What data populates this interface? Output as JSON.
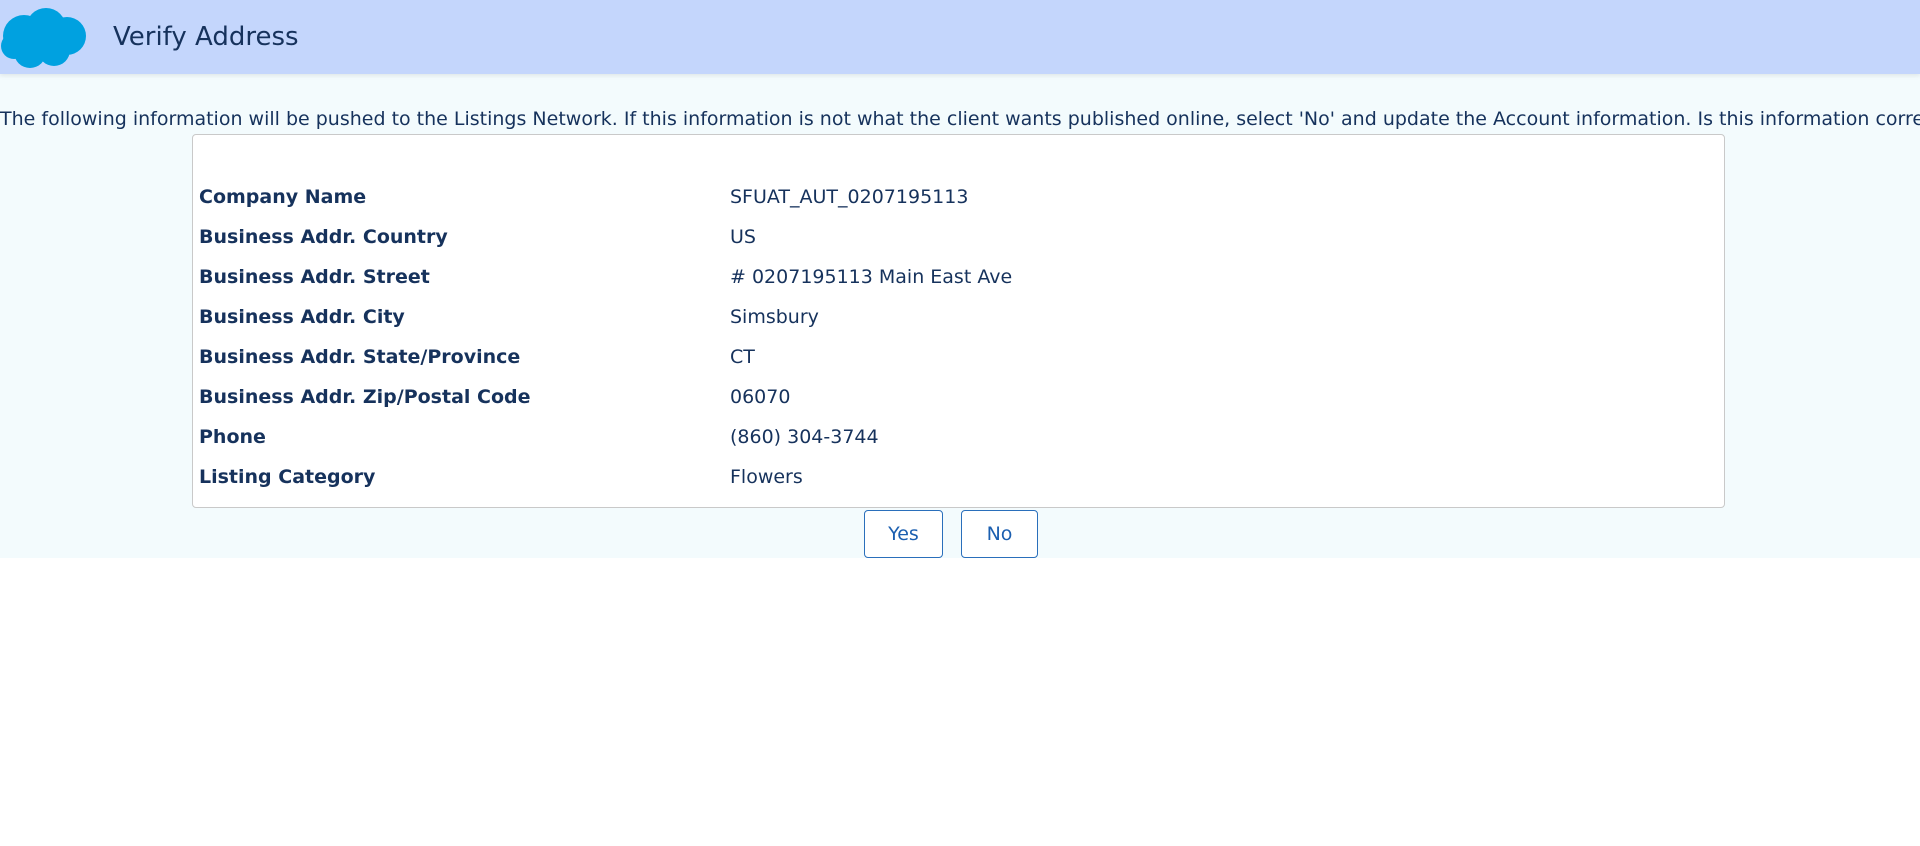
{
  "header": {
    "title": "Verify Address",
    "logo_icon": "salesforce-cloud-icon",
    "logo_color": "#00a1e0",
    "background_color": "#c4d6fc"
  },
  "intro_text": "The following information will be pushed to the Listings Network. If this information is not what the client wants published online, select 'No' and update the Account information. Is this information correct?",
  "details": {
    "company_name": {
      "label": "Company Name",
      "value": "SFUAT_AUT_0207195113"
    },
    "country": {
      "label": "Business Addr. Country",
      "value": "US"
    },
    "street": {
      "label": "Business Addr. Street",
      "value": "# 0207195113 Main East Ave"
    },
    "city": {
      "label": "Business Addr. City",
      "value": "Simsbury"
    },
    "state": {
      "label": "Business Addr. State/Province",
      "value": "CT"
    },
    "zip": {
      "label": "Business Addr. Zip/Postal Code",
      "value": "06070"
    },
    "phone": {
      "label": "Phone",
      "value": "(860) 304-3744"
    },
    "category": {
      "label": "Listing Category",
      "value": "Flowers"
    }
  },
  "actions": {
    "yes_label": "Yes",
    "no_label": "No",
    "accent_color": "#1b5fb0"
  }
}
